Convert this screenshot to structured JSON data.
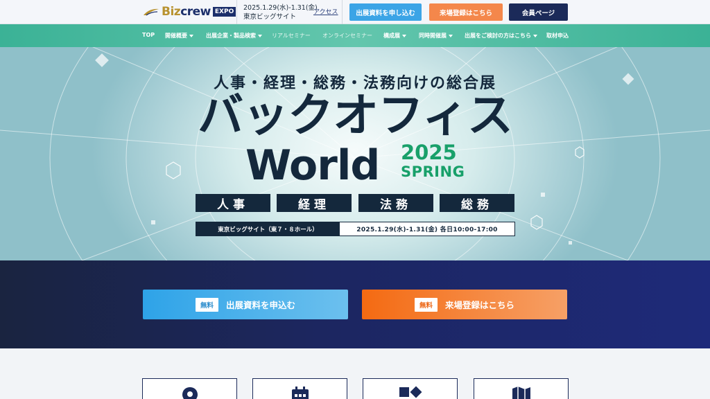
{
  "header": {
    "logo": {
      "biz": "Biz",
      "crew": "crew",
      "expo": "EXPO"
    },
    "date": "2025.1.29(水)-1.31(金)",
    "venue": "東京ビッグサイト",
    "access_label": "アクセス",
    "btn_exhibit": "出展資料を申し込む",
    "btn_visit": "来場登録はこちら",
    "btn_member": "会員ページ"
  },
  "nav": {
    "items": [
      {
        "label": "TOP"
      },
      {
        "label": "開催概要"
      },
      {
        "label": "出展企業・製品検索"
      },
      {
        "label": "リアルセミナー"
      },
      {
        "label": "オンラインセミナー"
      },
      {
        "label": "構成展"
      },
      {
        "label": "同時開催展"
      },
      {
        "label": "出展をご検討の方はこちら"
      },
      {
        "label": "取材申込"
      }
    ]
  },
  "hero": {
    "subtitle": "人事・経理・総務・法務向けの総合展",
    "title": "バックオフィス",
    "world": "World",
    "year": "2025",
    "season": "SPRING",
    "categories": [
      "人事",
      "経理",
      "法務",
      "総務"
    ],
    "venue": "東京ビッグサイト（東７・８ホール）",
    "dates": "2025.1.29(水)-1.31(金) 各日10:00-17:00"
  },
  "cta": {
    "free_label": "無料",
    "exhibit": "出展資料を申込む",
    "visit": "来場登録はこちら"
  },
  "colors": {
    "navy": "#1b2a59",
    "teal": "#3bb296",
    "green": "#18a06a",
    "blue": "#3ba4e6",
    "orange": "#f4874b"
  },
  "cards": [
    {
      "icon": "map-pin-icon"
    },
    {
      "icon": "calendar-icon"
    },
    {
      "icon": "shapes-icon"
    },
    {
      "icon": "map-icon"
    }
  ]
}
